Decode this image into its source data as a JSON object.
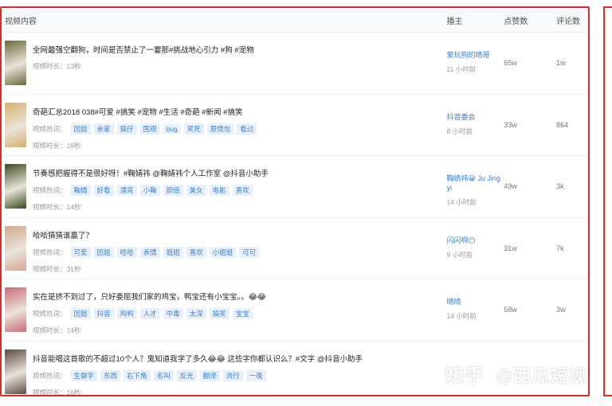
{
  "header": {
    "content": "视频内容",
    "author": "播主",
    "likes": "点赞数",
    "comments": "评论数"
  },
  "rows": [
    {
      "title": "全网最强空翻狗，时间是否禁止了一霎那#挑战地心引力 #狗 #宠物",
      "tags_label": "",
      "tags": [],
      "duration": "视频时长：13秒",
      "author": "爱玩狗的晴哥",
      "ago": "11 小时前",
      "likes": "65w",
      "comments": "1w"
    },
    {
      "title": "奇葩汇总2018 038#可爱 #搞笑 #宠物 #生活 #奇葩 #新闻 #搞笑",
      "tags_label": "视频热词：",
      "tags": [
        "因姐",
        "亲家",
        "搞仔",
        "围观",
        "bug",
        "笑死",
        "原情包",
        "看过"
      ],
      "duration": "视频时长：16秒",
      "author": "抖音委会",
      "ago": "8 小时前",
      "likes": "33w",
      "comments": "864"
    },
    {
      "title": "节奏感把握得不是很好呀！#鞠婧祎 @鞠婧祎个人工作室 @抖音小助手",
      "tags_label": "视频热词：",
      "tags": [
        "鞠婧",
        "好看",
        "漂亮",
        "小鞠",
        "颜值",
        "美女",
        "电影",
        "喜欢"
      ],
      "duration": "视频时长：14秒",
      "author": "鞠婧祎😀 Ju Jing yi",
      "ago": "14 小时前",
      "likes": "49w",
      "comments": "3k"
    },
    {
      "title": "哈哈猜猜谁赢了？",
      "tags_label": "视频热词：",
      "tags": [
        "可爱",
        "因姐",
        "哈哈",
        "表情",
        "姐姐",
        "喜欢",
        "小姐姐",
        "可可"
      ],
      "duration": "视频时长：31秒",
      "author": "闪闪啊😶",
      "ago": "9 小时前",
      "likes": "31w",
      "comments": "7k"
    },
    {
      "title": "实在是挤不到过了，只好委屈我们家的鸡宝，鸭宝还有小宝宝。。😂😂",
      "tags_label": "视频热词：",
      "tags": [
        "因姐",
        "抖音",
        "鸡鸭",
        "人才",
        "中毒",
        "太深",
        "搞笑",
        "宝宝"
      ],
      "duration": "视频时长：14秒",
      "author": "晴晴",
      "ago": "14 小时前",
      "likes": "58w",
      "comments": "3w"
    },
    {
      "title": "抖音能唱这首歌的不超过10个人？鬼知道我学了多久😂😂 这些字你都认识么？#文字 @抖音小助手",
      "tags_label": "视频热词：",
      "tags": [
        "生僻字",
        "东西",
        "右下角",
        "名叫",
        "反光",
        "翻译",
        "流行",
        "一夜"
      ],
      "duration": "视频时长：16秒",
      "author": "",
      "ago": "",
      "likes": "",
      "comments": ""
    }
  ],
  "thumb_colors": [
    "#6b6a3a",
    "#d8b070",
    "#3a4a20",
    "#d2a890",
    "#c96a78",
    "#5a4a44"
  ],
  "watermark": {
    "logo": "知乎",
    "text": "@西瓜短视"
  },
  "accent_color": "#e02a2a",
  "tag_color": "#3b82d6"
}
